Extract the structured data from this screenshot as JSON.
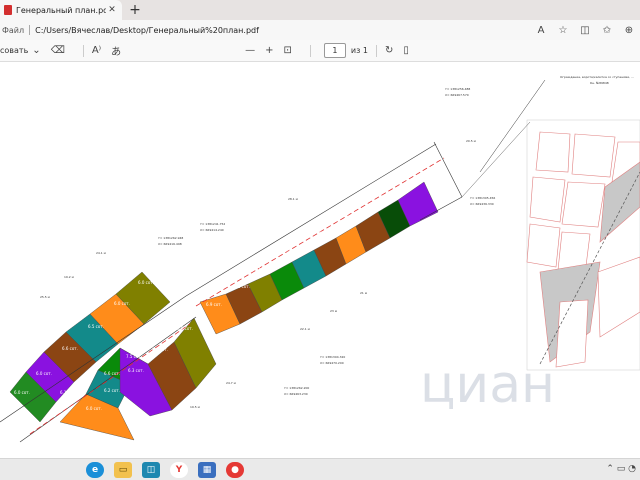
{
  "tab": {
    "title": "Генеральный план.pdf",
    "close_glyph": "✕"
  },
  "new_tab_glyph": "+",
  "address": {
    "site_label": "Файл",
    "url": "C:/Users/Вячеслав/Desktop/Генеральный%20план.pdf"
  },
  "toolbar": {
    "draw_label": "совать",
    "page_number": "1",
    "page_total": "из 1"
  },
  "document": {
    "north_note": "Ограждение, ворота/калитка со ступенями, ...",
    "north_note_sub": "Кн. №89848",
    "coords": [
      "Y= 1381256.488",
      "X= 669467.570",
      "Y= 1381305.456",
      "X= 669436.330",
      "Y= 1381241.752",
      "X= 669414.240",
      "Y= 1381262.948",
      "X= 669416.498",
      "Y= 1381304.320",
      "X= 669470.200",
      "Y= 1381262.200",
      "X= 669463.230"
    ],
    "plot_labels": [
      "6.0 сот.",
      "6.0 сот.",
      "6.0 сот.",
      "6.5 сот.",
      "6.6 сот.",
      "6.4 сот.",
      "6.3 сот.",
      "6.2 сот.",
      "6.9 сот.",
      "6.0 сот.",
      "6.0 сот.",
      "6.0 сот.",
      "6.2 сот.",
      "7.0 сот.",
      "7.2 сот.",
      "6.7 сот.",
      "6.6 сот.",
      "6.3 сот.",
      "6.5 сот.",
      "6.5 сот.",
      "6.1 сот.",
      "6.6 сот.",
      "7.5 сот."
    ],
    "dims": [
      "28.1 м",
      "20.5 м",
      "24.1 м",
      "19.2 м",
      "22.1 м",
      "23 м",
      "21 м",
      "25.5 м",
      "24.7 м",
      "19.5 м"
    ]
  },
  "watermark": "циан"
}
